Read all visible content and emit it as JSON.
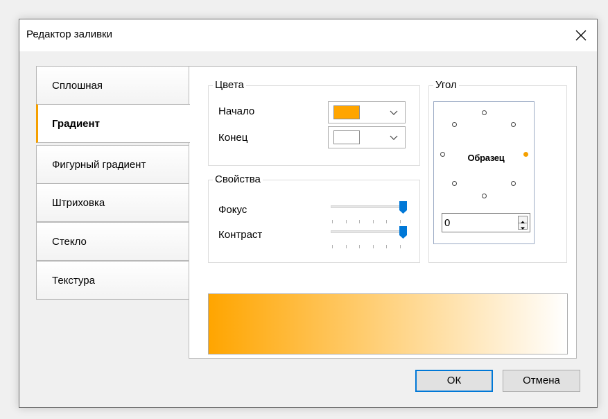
{
  "window": {
    "title": "Редактор заливки"
  },
  "tabs": [
    {
      "label": "Сплошная"
    },
    {
      "label": "Градиент"
    },
    {
      "label": "Фигурный градиент"
    },
    {
      "label": "Штриховка"
    },
    {
      "label": "Стекло"
    },
    {
      "label": "Текстура"
    }
  ],
  "active_tab": "Градиент",
  "colors_group": {
    "title": "Цвета",
    "start_label": "Начало",
    "start_color": "#ffa500",
    "end_label": "Конец",
    "end_color": "#ffffff"
  },
  "properties_group": {
    "title": "Свойства",
    "focus_label": "Фокус",
    "focus_value": 1.0,
    "contrast_label": "Контраст",
    "contrast_value": 1.0
  },
  "angle_group": {
    "title": "Угол",
    "sample_label": "Образец",
    "angle_value": "0",
    "angle_options": [
      0,
      45,
      90,
      135,
      180,
      225,
      270,
      315
    ],
    "selected_angle": 0
  },
  "buttons": {
    "ok_label": "ОК",
    "cancel_label": "Отмена"
  },
  "accent_color": "#f5a000",
  "default_button_border_color": "#0078d7",
  "slider_thumb_color": "#0078d7"
}
